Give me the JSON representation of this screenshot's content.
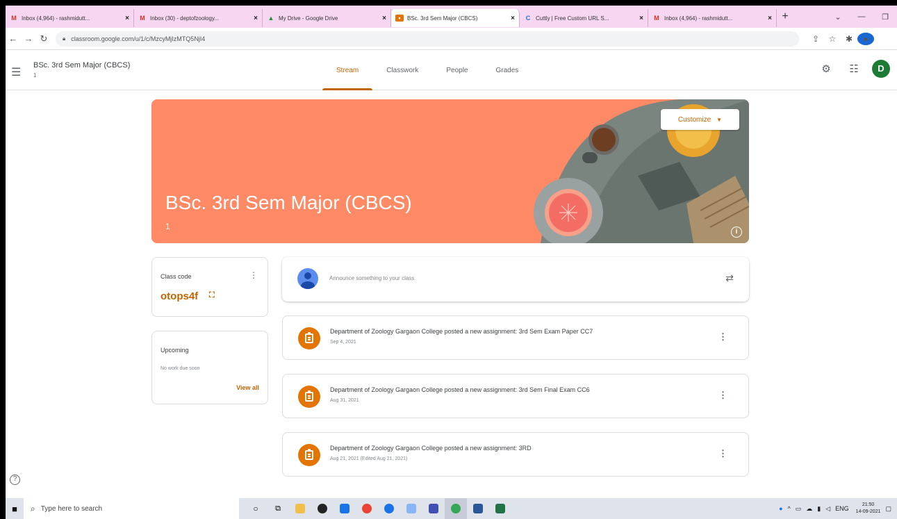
{
  "browser": {
    "tabs": [
      {
        "label": "Inbox (4,964) - rashmidutt...",
        "favicon": "gmail-icon",
        "color": "#d93025",
        "active": false
      },
      {
        "label": "Inbox (30) - deptofzoology...",
        "favicon": "gmail-icon",
        "color": "#d93025",
        "active": false
      },
      {
        "label": "My Drive - Google Drive",
        "favicon": "drive-icon",
        "color": "#1e8e3e",
        "active": false
      },
      {
        "label": "BSc. 3rd Sem Major (CBCS)",
        "favicon": "classroom-icon",
        "color": "#e37400",
        "active": true
      },
      {
        "label": "Cuttly | Free Custom URL S...",
        "favicon": "cuttly-icon",
        "color": "#1a73e8",
        "active": false
      },
      {
        "label": "Inbox (4,964) - rashmidutt...",
        "favicon": "gmail-icon",
        "color": "#d93025",
        "active": false
      }
    ],
    "new_tab": "+",
    "url": "classroom.google.com/u/1/c/MzcyMjIzMTQ5NjI4"
  },
  "header": {
    "class_title": "BSc. 3rd Sem Major (CBCS)",
    "class_section": "1",
    "tabs": [
      {
        "label": "Stream",
        "active": true
      },
      {
        "label": "Classwork",
        "active": false
      },
      {
        "label": "People",
        "active": false
      },
      {
        "label": "Grades",
        "active": false
      }
    ],
    "avatar_letter": "D"
  },
  "banner": {
    "title": "BSc. 3rd Sem Major (CBCS)",
    "section": "1",
    "customize_label": "Customize",
    "accent_color": "#ff8a65"
  },
  "class_code": {
    "label": "Class code",
    "value": "otops4f"
  },
  "upcoming": {
    "label": "Upcoming",
    "empty_text": "No work due soon",
    "view_all": "View all"
  },
  "announce": {
    "placeholder": "Announce something to your class"
  },
  "posts": [
    {
      "title": "Department of Zoology Gargaon College posted a new assignment: 3rd Sem Exam Paper CC7",
      "date": "Sep 4, 2021"
    },
    {
      "title": "Department of Zoology Gargaon College posted a new assignment: 3rd Sem Final Exam CC6",
      "date": "Aug 31, 2021"
    },
    {
      "title": "Department of Zoology Gargaon College posted a new assignment: 3RD",
      "date": "Aug 21, 2021 (Edited Aug 21, 2021)"
    }
  ],
  "taskbar": {
    "search_placeholder": "Type here to search",
    "language": "ENG",
    "time": "21:50",
    "date": "14-09-2021"
  },
  "colors": {
    "classroom_accent": "#c26401",
    "assignment_icon": "#e37400"
  }
}
